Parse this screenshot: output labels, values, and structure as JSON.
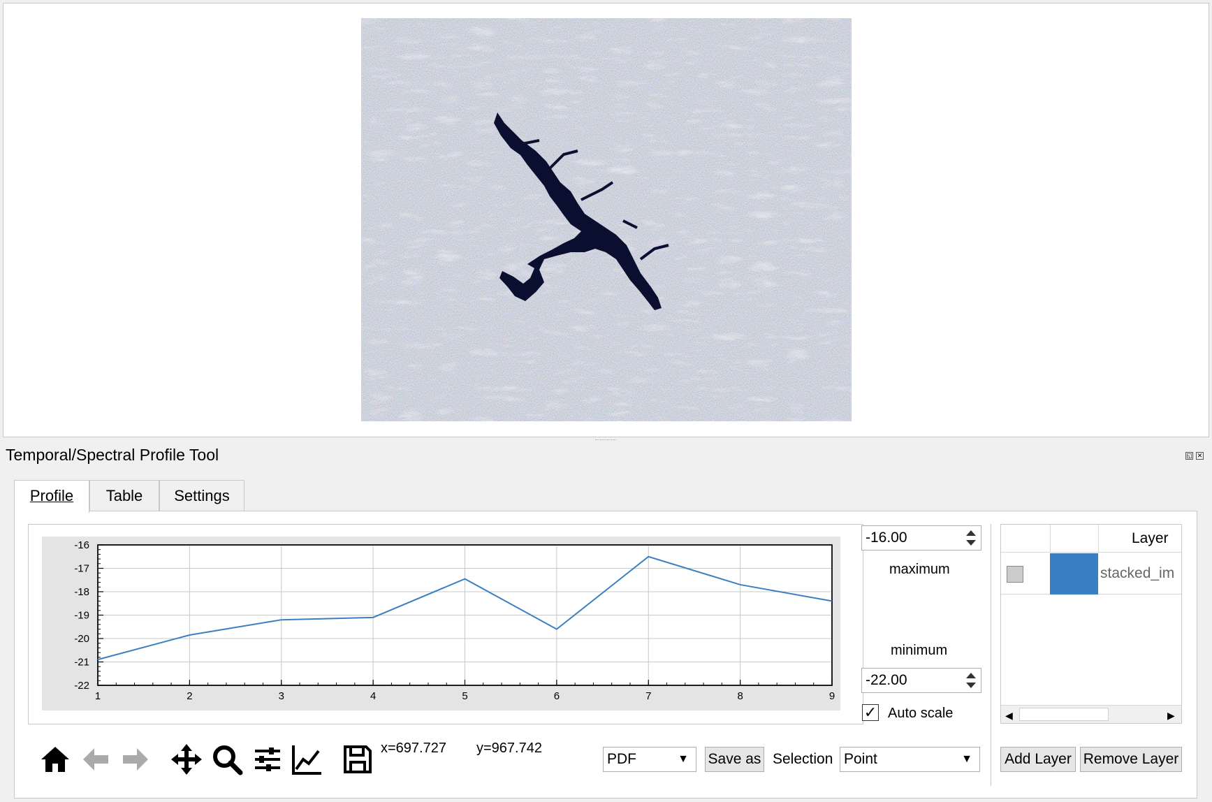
{
  "panel": {
    "title": "Temporal/Spectral Profile Tool"
  },
  "tabs": [
    {
      "label": "Profile",
      "active": true
    },
    {
      "label": "Table",
      "active": false
    },
    {
      "label": "Settings",
      "active": false
    }
  ],
  "scale": {
    "maximum_value": "-16.00",
    "maximum_label": "maximum",
    "minimum_value": "-22.00",
    "minimum_label": "minimum",
    "autoscale_label": "Auto scale",
    "autoscale_checked": true
  },
  "layers": {
    "header": "Layer",
    "rows": [
      {
        "name": "stacked_im",
        "color": "#3a7fc1",
        "checked": false
      }
    ],
    "add_label": "Add Layer",
    "remove_label": "Remove Layer"
  },
  "toolbar": {
    "icons": [
      "home-icon",
      "back-arrow-icon",
      "forward-arrow-icon",
      "pan-icon",
      "zoom-icon",
      "configure-subplots-icon",
      "edit-axis-icon",
      "save-icon"
    ],
    "coord_x": "x=697.727",
    "coord_y": "y=967.742",
    "format_value": "PDF",
    "save_as_label": "Save as",
    "selection_label": "Selection",
    "selection_value": "Point"
  },
  "colors": {
    "line": "#3a7fc1",
    "water": "#0a0f30"
  },
  "chart_data": {
    "type": "line",
    "x": [
      1,
      2,
      3,
      4,
      5,
      6,
      7,
      8,
      9
    ],
    "series": [
      {
        "values": [
          -20.9,
          -19.85,
          -19.2,
          -19.1,
          -17.45,
          -19.6,
          -16.5,
          -17.7,
          -18.4
        ]
      }
    ],
    "xlim": [
      1,
      9
    ],
    "ylim": [
      -22,
      -16
    ],
    "xticks": [
      "1",
      "2",
      "3",
      "4",
      "5",
      "6",
      "7",
      "8",
      "9"
    ],
    "yticks": [
      "-16",
      "-17",
      "-18",
      "-19",
      "-20",
      "-21",
      "-22"
    ],
    "grid": true
  }
}
